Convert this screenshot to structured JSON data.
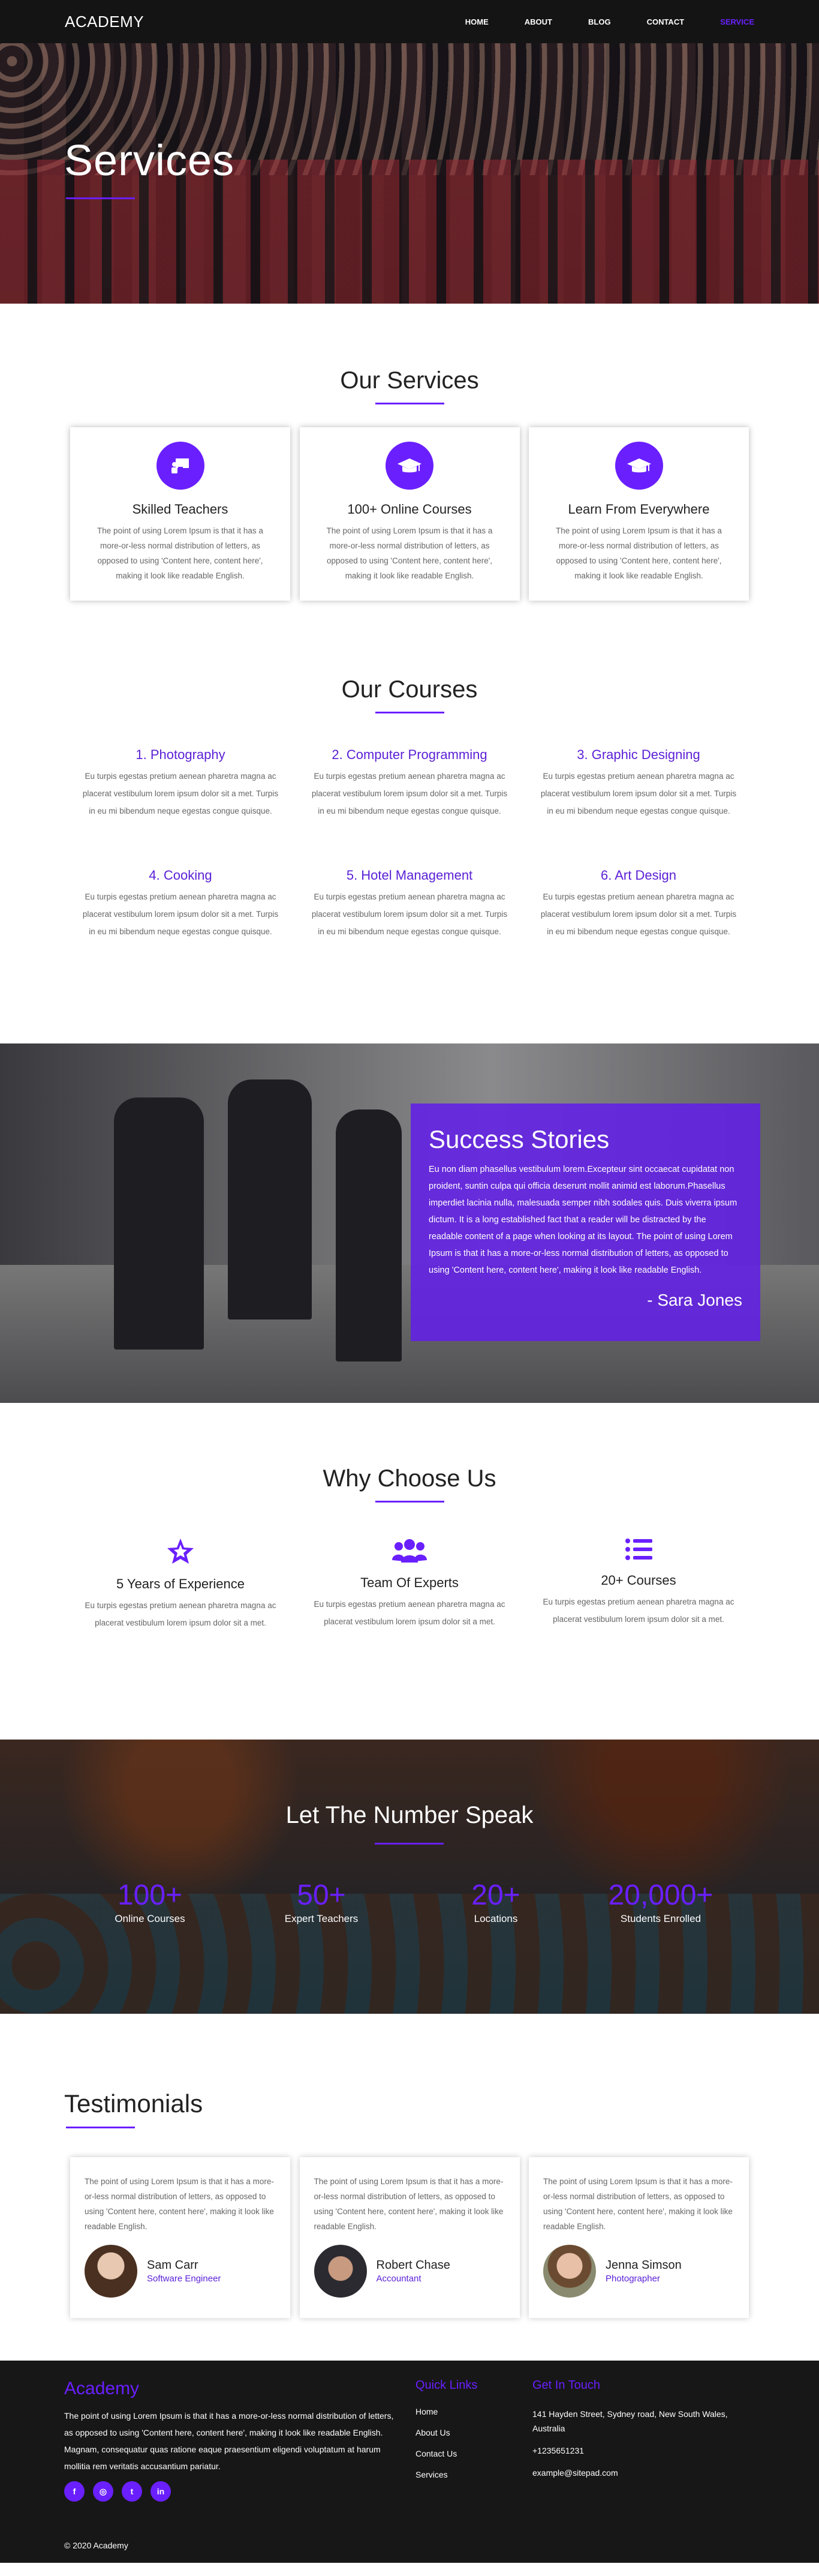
{
  "nav": {
    "logo": "ACADEMY",
    "items": [
      "HOME",
      "ABOUT",
      "BLOG",
      "CONTACT",
      "SERVICE"
    ],
    "active_color": "#6a1fff"
  },
  "hero": {
    "title": "Services"
  },
  "services": {
    "title": "Our Services",
    "items": [
      {
        "icon": "presentation-icon",
        "title": "Skilled Teachers",
        "text": "The point of using Lorem Ipsum is that it has a more-or-less normal distribution of letters, as opposed to using 'Content here, content here', making it look like readable English."
      },
      {
        "icon": "graduation-cap-icon",
        "title": "100+ Online Courses",
        "text": "The point of using Lorem Ipsum is that it has a more-or-less normal distribution of letters, as opposed to using 'Content here, content here', making it look like readable English."
      },
      {
        "icon": "graduation-cap-icon",
        "title": "Learn From Everywhere",
        "text": "The point of using Lorem Ipsum is that it has a more-or-less normal distribution of letters, as opposed to using 'Content here, content here', making it look like readable English."
      }
    ]
  },
  "courses": {
    "title": "Our Courses",
    "items": [
      {
        "title": "1. Photography",
        "text": "Eu turpis egestas pretium aenean pharetra magna ac placerat vestibulum lorem ipsum dolor sit a met. Turpis in eu mi bibendum neque egestas congue quisque."
      },
      {
        "title": "2. Computer Programming",
        "text": "Eu turpis egestas pretium aenean pharetra magna ac placerat vestibulum lorem ipsum dolor sit a met. Turpis in eu mi bibendum neque egestas congue quisque."
      },
      {
        "title": "3. Graphic Designing",
        "text": "Eu turpis egestas pretium aenean pharetra magna ac placerat vestibulum lorem ipsum dolor sit a met. Turpis in eu mi bibendum neque egestas congue quisque."
      },
      {
        "title": "4. Cooking",
        "text": "Eu turpis egestas pretium aenean pharetra magna ac placerat vestibulum lorem ipsum dolor sit a met. Turpis in eu mi bibendum neque egestas congue quisque."
      },
      {
        "title": "5. Hotel Management",
        "text": "Eu turpis egestas pretium aenean pharetra magna ac placerat vestibulum lorem ipsum dolor sit a met. Turpis in eu mi bibendum neque egestas congue quisque."
      },
      {
        "title": "6. Art Design",
        "text": "Eu turpis egestas pretium aenean pharetra magna ac placerat vestibulum lorem ipsum dolor sit a met. Turpis in eu mi bibendum neque egestas congue quisque."
      }
    ]
  },
  "success": {
    "title": "Success Stories",
    "text": "Eu non diam phasellus vestibulum lorem.Excepteur sint occaecat cupidatat non proident, suntin culpa qui officia deserunt mollit animid est laborum.Phasellus imperdiet lacinia nulla, malesuada semper nibh sodales quis. Duis viverra ipsum dictum. It is a long established fact that a reader will be distracted by the readable content of a page when looking at its layout. The point of using Lorem Ipsum is that it has a more-or-less normal distribution of letters, as opposed to using 'Content here, content here', making it look like readable English.",
    "author": "- Sara Jones"
  },
  "why": {
    "title": "Why Choose Us",
    "items": [
      {
        "icon": "star-icon",
        "title": "5 Years of Experience",
        "text": "Eu turpis egestas pretium aenean pharetra magna ac placerat vestibulum lorem ipsum dolor sit a met."
      },
      {
        "icon": "users-icon",
        "title": "Team Of Experts",
        "text": "Eu turpis egestas pretium aenean pharetra magna ac placerat vestibulum lorem ipsum dolor sit a met."
      },
      {
        "icon": "list-icon",
        "title": "20+ Courses",
        "text": "Eu turpis egestas pretium aenean pharetra magna ac placerat vestibulum lorem ipsum dolor sit a met."
      }
    ]
  },
  "numbers": {
    "title": "Let The Number Speak",
    "stats": [
      {
        "value": "100+",
        "label": "Online Courses"
      },
      {
        "value": "50+",
        "label": "Expert Teachers"
      },
      {
        "value": "20+",
        "label": "Locations"
      },
      {
        "value": "20,000+",
        "label": "Students Enrolled"
      }
    ]
  },
  "testimonials": {
    "title": "Testimonials",
    "items": [
      {
        "text": "The point of using Lorem Ipsum is that it has a more-or-less normal distribution of letters, as opposed to using 'Content here, content here', making it look like readable English.",
        "name": "Sam Carr",
        "role": "Software Engineer"
      },
      {
        "text": "The point of using Lorem Ipsum is that it has a more-or-less normal distribution of letters, as opposed to using 'Content here, content here', making it look like readable English.",
        "name": "Robert Chase",
        "role": "Accountant"
      },
      {
        "text": "The point of using Lorem Ipsum is that it has a more-or-less normal distribution of letters, as opposed to using 'Content here, content here', making it look like readable English.",
        "name": "Jenna Simson",
        "role": "Photographer"
      }
    ]
  },
  "footer": {
    "brand": "Academy",
    "about": "The point of using Lorem Ipsum is that it has a more-or-less normal distribution of letters, as opposed to using 'Content here, content here', making it look like readable English. Magnam, consequatur quas ratione eaque praesentium eligendi voluptatum at harum mollitia rem veritatis accusantium pariatur.",
    "socials": [
      {
        "icon": "facebook-icon",
        "glyph": "f"
      },
      {
        "icon": "instagram-icon",
        "glyph": "◎"
      },
      {
        "icon": "twitter-icon",
        "glyph": "t"
      },
      {
        "icon": "linkedin-icon",
        "glyph": "in"
      }
    ],
    "links_title": "Quick Links",
    "links": [
      "Home",
      "About Us",
      "Contact Us",
      "Services"
    ],
    "contact_title": "Get In Touch",
    "address": "141 Hayden Street, Sydney road, New South Wales, Australia",
    "phone": "+1235651231",
    "email": "example@sitepad.com",
    "copyright": "© 2020 Academy"
  }
}
